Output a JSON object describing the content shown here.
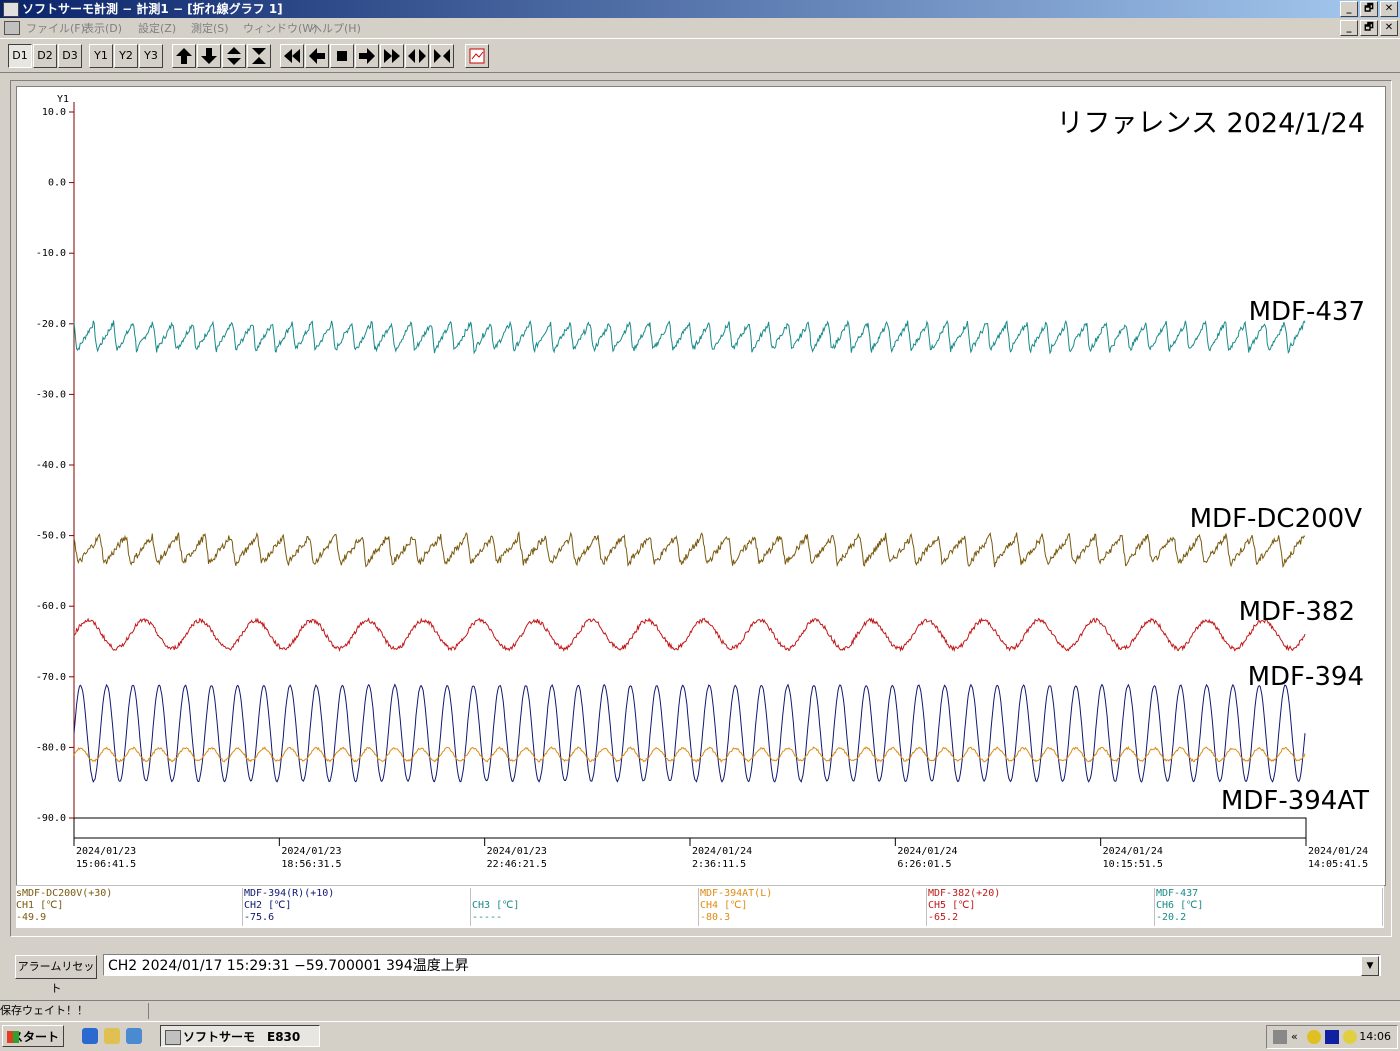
{
  "window": {
    "title": "ソフトサーモ計測 − 計測1 − [折れ線グラフ 1]",
    "buttons": [
      "_",
      "🗗",
      "✕"
    ]
  },
  "menu": [
    "ファイル(F)",
    "表示(D)",
    "設定(Z)",
    "測定(S)",
    "ウィンドウ(W)",
    "ヘルプ(H)"
  ],
  "toolbar": {
    "display_buttons": [
      "D1",
      "D2",
      "D3"
    ],
    "axis_buttons": [
      "Y1",
      "Y2",
      "Y3"
    ],
    "icons": [
      "arrow-up-icon",
      "arrow-down-icon",
      "expand-vertical-icon",
      "shrink-vertical-icon",
      "fast-rewind-icon",
      "arrow-left-icon",
      "stop-icon",
      "arrow-right-icon",
      "fast-forward-icon",
      "expand-horizontal-icon",
      "shrink-horizontal-icon",
      "graph-settings-icon"
    ]
  },
  "chart_data": {
    "type": "line",
    "title": "リファレンス 2024/1/24",
    "ylabel": "Y1",
    "ylim": [
      -90,
      10
    ],
    "yticks": [
      "10.0",
      "0.0",
      "-10.0",
      "-20.0",
      "-30.0",
      "-40.0",
      "-50.0",
      "-60.0",
      "-70.0",
      "-80.0",
      "-90.0"
    ],
    "x_ticks": [
      {
        "date": "2024/01/23",
        "time": "15:06:41.5"
      },
      {
        "date": "2024/01/23",
        "time": "18:56:31.5"
      },
      {
        "date": "2024/01/23",
        "time": "22:46:21.5"
      },
      {
        "date": "2024/01/24",
        "time": "2:36:11.5"
      },
      {
        "date": "2024/01/24",
        "time": "6:26:01.5"
      },
      {
        "date": "2024/01/24",
        "time": "10:15:51.5"
      },
      {
        "date": "2024/01/24",
        "time": "14:05:41.5"
      }
    ],
    "series": [
      {
        "name": "MDF-437",
        "color": "#1a8a8a",
        "center": -21.8,
        "amplitude": 2.0,
        "cycles": 62,
        "shape": "sawtooth",
        "noise": 0.4
      },
      {
        "name": "MDF-DC200V",
        "color": "#7a5a10",
        "center": -52.0,
        "amplitude": 2.0,
        "cycles": 47,
        "shape": "sawtooth",
        "noise": 0.5
      },
      {
        "name": "MDF-382",
        "color": "#c01818",
        "center": -64.0,
        "amplitude": 2.0,
        "cycles": 22,
        "shape": "sine",
        "noise": 0.3
      },
      {
        "name": "MDF-394",
        "color": "#101870",
        "center": -78.0,
        "amplitude": 6.8,
        "cycles": 47,
        "shape": "sine",
        "noise": 0.1
      },
      {
        "name": "MDF-394AT",
        "color": "#e08a10",
        "center": -81.0,
        "amplitude": 0.9,
        "cycles": 47,
        "shape": "sine",
        "noise": 0.15
      }
    ],
    "series_labels": [
      "MDF-437",
      "MDF-DC200V",
      "MDF-382",
      "MDF-394",
      "MDF-394AT"
    ],
    "grid": false
  },
  "legend": [
    {
      "name": "sMDF-DC200V(+30)",
      "ch": "CH1 [℃]",
      "value": "-49.9",
      "color": "#7a5a10"
    },
    {
      "name": "MDF-394(R)(+10)",
      "ch": "CH2 [℃]",
      "value": "-75.6",
      "color": "#101870"
    },
    {
      "name": "",
      "ch": "CH3 [℃]",
      "value": "-----",
      "color": "#1a8a8a"
    },
    {
      "name": "MDF-394AT(L)",
      "ch": "CH4 [℃]",
      "value": "-80.3",
      "color": "#e08a10"
    },
    {
      "name": "MDF-382(+20)",
      "ch": "CH5 [℃]",
      "value": "-65.2",
      "color": "#c01818"
    },
    {
      "name": "MDF-437",
      "ch": "CH6 [℃]",
      "value": "-20.2",
      "color": "#1a8a8a"
    }
  ],
  "alarm": {
    "reset_label": "アラームリセット",
    "message": "CH2 2024/01/17 15:29:31 −59.700001 394温度上昇"
  },
  "status": {
    "text": "保存ウェイト！！"
  },
  "taskbar": {
    "start_label": "スタート",
    "app_label": "ソフトサーモ　E830",
    "clock": "14:06"
  }
}
